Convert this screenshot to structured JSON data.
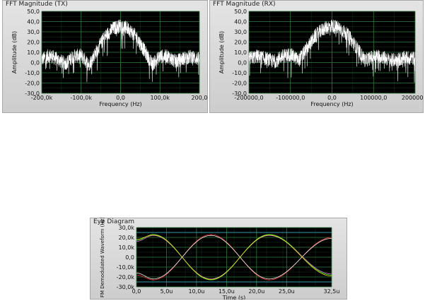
{
  "chart_data": [
    {
      "type": "line",
      "title": "FFT Magnitude (TX)",
      "xlabel": "Frequency (Hz)",
      "ylabel": "Amplitude (dB)",
      "xlim": [
        -200000,
        200000
      ],
      "ylim": [
        -30,
        50
      ],
      "x_tick_labels": [
        "-200,0k",
        "-100,0k",
        "0,0",
        "100,0k",
        "200,0"
      ],
      "y_tick_labels": [
        "50,0",
        "40,0",
        "30,0",
        "20,0",
        "10,0",
        "0,0",
        "-10,0",
        "-20,0",
        "-30,0"
      ],
      "background": "#000000",
      "line_color": "#ffffff",
      "grid": true,
      "grid_color": "#2f7a3a",
      "envelope": {
        "x": [
          -200000,
          -180000,
          -160000,
          -140000,
          -120000,
          -100000,
          -80000,
          -60000,
          -40000,
          -20000,
          0,
          20000,
          40000,
          60000,
          80000,
          100000,
          120000,
          140000,
          160000,
          180000,
          200000
        ],
        "y": [
          3,
          7,
          3,
          -1,
          6,
          7,
          -2,
          12,
          25,
          33,
          36,
          33,
          25,
          12,
          -2,
          6,
          6,
          1,
          4,
          6,
          3
        ]
      }
    },
    {
      "type": "line",
      "title": "FFT Magnitude (RX)",
      "xlabel": "Frequency (Hz)",
      "ylabel": "Amplitude (dB)",
      "xlim": [
        -200000,
        200000
      ],
      "ylim": [
        -30,
        50
      ],
      "x_tick_labels": [
        "-200000,0",
        "-100000,0",
        "0,0",
        "100000,0",
        "200000,0"
      ],
      "y_tick_labels": [
        "50,0",
        "40,0",
        "30,0",
        "20,0",
        "10,0",
        "0,0",
        "-10,0",
        "-20,0",
        "-30,0"
      ],
      "background": "#000000",
      "line_color": "#ffffff",
      "grid": true,
      "grid_color": "#2f7a3a",
      "envelope": {
        "x": [
          -200000,
          -180000,
          -160000,
          -140000,
          -120000,
          -100000,
          -80000,
          -60000,
          -40000,
          -20000,
          0,
          20000,
          40000,
          60000,
          80000,
          100000,
          120000,
          140000,
          160000,
          180000,
          200000
        ],
        "y": [
          4,
          6,
          4,
          1,
          6,
          8,
          2,
          14,
          26,
          33,
          36,
          33,
          26,
          14,
          2,
          6,
          6,
          2,
          3,
          5,
          4
        ]
      }
    },
    {
      "type": "line",
      "title": "Eye Diagram",
      "xlabel": "Time (s)",
      "ylabel": "FM Demodulated Waveform (Hz)",
      "xlim": [
        0,
        32.5
      ],
      "ylim": [
        -30000,
        30000
      ],
      "x_tick_labels": [
        "0,0",
        "5,0u",
        "10,0u",
        "15,0u",
        "20,0u",
        "25,0u",
        "32,5u"
      ],
      "x_tick_values": [
        0,
        5,
        10,
        15,
        20,
        25,
        32.5
      ],
      "y_tick_labels": [
        "30,0k",
        "20,0k",
        "10,0k",
        "0,0",
        "-10,0k",
        "-20,0k",
        "-30,0k"
      ],
      "background": "#000000",
      "grid": true,
      "grid_color": "#2f7a3a",
      "series": [
        {
          "color": "#e03030",
          "x": [
            0,
            2.8,
            12.4,
            22.1,
            32.5
          ],
          "y": [
            -18000,
            -23000,
            23000,
            -23000,
            20000
          ]
        },
        {
          "color": "#30d040",
          "x": [
            0,
            2.8,
            12.4,
            22.1,
            32.5
          ],
          "y": [
            17000,
            23000,
            -23000,
            23000,
            -18000
          ]
        },
        {
          "color": "#f0f0f0",
          "x": [
            0,
            2.8,
            12.4,
            22.1,
            32.5
          ],
          "y": [
            -16000,
            -22000,
            22000,
            -22000,
            19000
          ]
        },
        {
          "color": "#d070d0",
          "x": [
            0,
            2.8,
            12.4,
            22.1,
            32.5
          ],
          "y": [
            16000,
            22000,
            -22000,
            22000,
            -17000
          ]
        },
        {
          "color": "#e6e600",
          "x": [
            0,
            2.8,
            12.4,
            22.1,
            32.5
          ],
          "y": [
            18000,
            22500,
            -22500,
            22500,
            -19000
          ]
        },
        {
          "color": "#40c8e0",
          "x": [
            0,
            32.5
          ],
          "y": [
            25000,
            25000
          ]
        },
        {
          "color": "#40c8e0",
          "x": [
            0,
            32.5
          ],
          "y": [
            -25000,
            -25000
          ]
        }
      ]
    }
  ]
}
